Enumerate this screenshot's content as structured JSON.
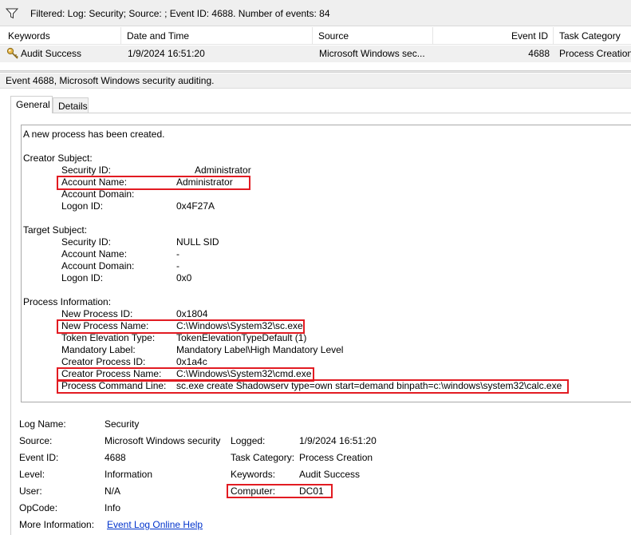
{
  "filter": {
    "icon": "funnel-icon",
    "text": "Filtered: Log: Security; Source: ; Event ID: 4688. Number of events: 84"
  },
  "event_list": {
    "columns": [
      "Keywords",
      "Date and Time",
      "Source",
      "Event ID",
      "Task Category"
    ],
    "rows": [
      {
        "icon": "key-icon",
        "keywords": "Audit Success",
        "date": "1/9/2024 16:51:20",
        "source": "Microsoft Windows sec...",
        "event_id": "4688",
        "task_category": "Process Creation"
      }
    ]
  },
  "detail": {
    "title": "Event 4688, Microsoft Windows security auditing.",
    "tabs": [
      "General",
      "Details"
    ],
    "selected_tab": "General"
  },
  "message": {
    "intro": "A new process has been created.",
    "creator_subject": {
      "heading": "Creator Subject:",
      "fields": [
        {
          "label": "Security ID:",
          "value": "Administrator"
        },
        {
          "label": "Account Name:",
          "value": "Administrator"
        },
        {
          "label": "Account Domain:",
          "value": ""
        },
        {
          "label": "Logon ID:",
          "value": "0x4F27A"
        }
      ]
    },
    "target_subject": {
      "heading": "Target Subject:",
      "fields": [
        {
          "label": "Security ID:",
          "value": "NULL SID"
        },
        {
          "label": "Account Name:",
          "value": "-"
        },
        {
          "label": "Account Domain:",
          "value": "-"
        },
        {
          "label": "Logon ID:",
          "value": "0x0"
        }
      ]
    },
    "process_information": {
      "heading": "Process Information:",
      "fields": [
        {
          "label": "New Process ID:",
          "value": "0x1804"
        },
        {
          "label": "New Process Name:",
          "value": "C:\\Windows\\System32\\sc.exe"
        },
        {
          "label": "Token Elevation Type:",
          "value": "TokenElevationTypeDefault (1)"
        },
        {
          "label": "Mandatory Label:",
          "value": "Mandatory Label\\High Mandatory Level"
        },
        {
          "label": "Creator Process ID:",
          "value": "0x1a4c"
        },
        {
          "label": "Creator Process Name:",
          "value": "C:\\Windows\\System32\\cmd.exe"
        },
        {
          "label": "Process Command Line:",
          "value": "sc.exe  create Shadowserv type=own start=demand  binpath=c:\\windows\\system32\\calc.exe"
        }
      ]
    }
  },
  "summary": {
    "log_name": {
      "label": "Log Name:",
      "value": "Security"
    },
    "source": {
      "label": "Source:",
      "value": "Microsoft Windows security"
    },
    "logged": {
      "label": "Logged:",
      "value": "1/9/2024 16:51:20"
    },
    "event_id": {
      "label": "Event ID:",
      "value": "4688"
    },
    "task_category": {
      "label": "Task Category:",
      "value": "Process Creation"
    },
    "level": {
      "label": "Level:",
      "value": "Information"
    },
    "keywords": {
      "label": "Keywords:",
      "value": "Audit Success"
    },
    "user": {
      "label": "User:",
      "value": "N/A"
    },
    "computer": {
      "label": "Computer:",
      "value": "DC01"
    },
    "opcode": {
      "label": "OpCode:",
      "value": "Info"
    },
    "more_info": {
      "label": "More Information:",
      "link": "Event Log Online Help"
    }
  },
  "colors": {
    "highlight": "#e21b22",
    "link": "#0033cc",
    "row_selected": "#f0f0f0"
  }
}
